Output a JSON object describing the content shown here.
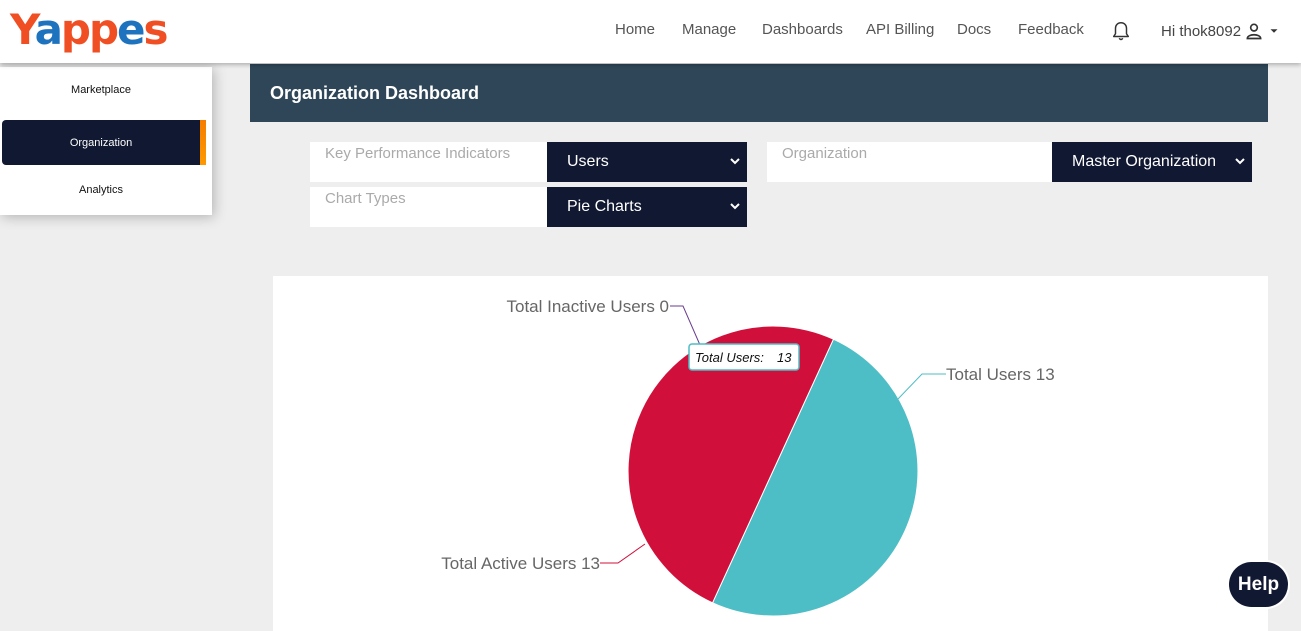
{
  "app": {
    "logo_text": "Yappes",
    "logo_colors": {
      "primary": "#f04e23",
      "secondary": "#1e73be"
    }
  },
  "nav": {
    "items": [
      {
        "label": "Home"
      },
      {
        "label": "Manage"
      },
      {
        "label": "Dashboards"
      },
      {
        "label": "API Billing"
      },
      {
        "label": "Docs"
      },
      {
        "label": "Feedback"
      }
    ],
    "notification_icon": "bell-icon",
    "user_greeting": "Hi thok8092",
    "user_icon": "person-icon"
  },
  "sidebar": {
    "items": [
      {
        "label": "Marketplace",
        "active": false
      },
      {
        "label": "Organization",
        "active": true
      },
      {
        "label": "Analytics",
        "active": false
      }
    ]
  },
  "page": {
    "title": "Organization Dashboard"
  },
  "filters": {
    "kpi": {
      "label": "Key Performance Indicators",
      "value": "Users"
    },
    "organization": {
      "label": "Organization",
      "value": "Master Organization"
    },
    "chart_type": {
      "label": "Chart Types",
      "value": "Pie Charts"
    }
  },
  "chart_data": {
    "type": "pie",
    "slices": [
      {
        "label": "Total Users",
        "value": 13,
        "color": "#4dbdc6"
      },
      {
        "label": "Total Active Users",
        "value": 13,
        "color": "#d0103a"
      },
      {
        "label": "Total Inactive Users",
        "value": 0,
        "color": "#6a3d8f"
      }
    ],
    "data_labels": [
      "Total Users 13",
      "Total Active Users 13",
      "Total Inactive Users 0"
    ],
    "tooltip": {
      "label": "Total Users:",
      "value": "13"
    }
  },
  "help": {
    "label": "Help"
  },
  "colors": {
    "header": "#2e4657",
    "dark": "#111832",
    "accent": "#f57c00",
    "background": "#eeeeee"
  }
}
